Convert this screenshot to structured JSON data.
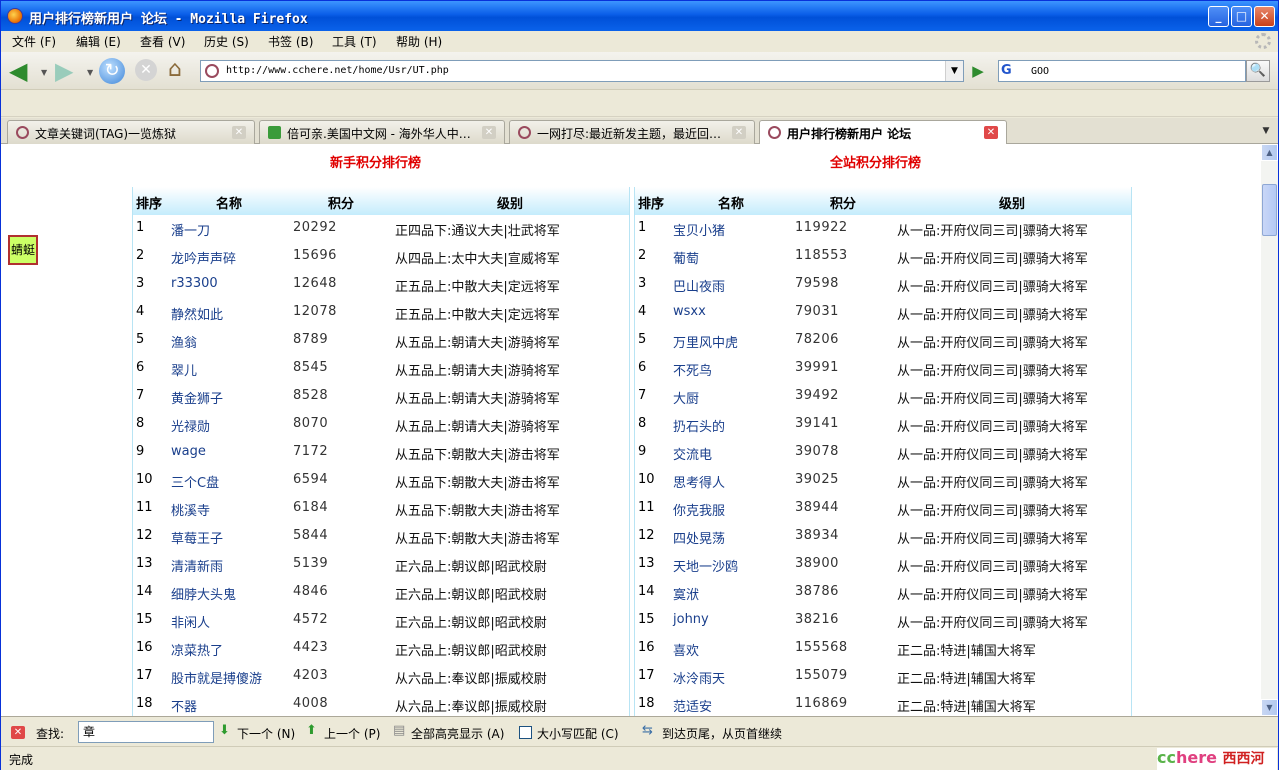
{
  "window": {
    "title": "用户排行榜新用户  论坛 - Mozilla Firefox"
  },
  "menu": [
    "文件 (F)",
    "编辑 (E)",
    "查看 (V)",
    "历史 (S)",
    "书签 (B)",
    "工具 (T)",
    "帮助 (H)"
  ],
  "nav": {
    "url": "http://www.cchere.net/home/Usr/UT.php",
    "search_engine": "G",
    "search_value": "GOO"
  },
  "tabs": [
    {
      "label": "文章关键词(TAG)一览炼狱",
      "active": false
    },
    {
      "label": "倍可亲.美国中文网 - 海外华人中…",
      "active": false
    },
    {
      "label": "一网打尽:最近新发主题，最近回…",
      "active": false
    },
    {
      "label": "用户排行榜新用户  论坛",
      "active": true
    }
  ],
  "page": {
    "badge": "蜻蜓",
    "headers": {
      "rank": "排序",
      "name": "名称",
      "score": "积分",
      "level": "级别"
    },
    "newbie": {
      "title": "新手积分排行榜",
      "rows": [
        {
          "rank": "1",
          "name": "潘一刀",
          "score": "20292",
          "level": "正四品下:通议大夫|壮武将军"
        },
        {
          "rank": "2",
          "name": "龙吟声声碎",
          "score": "15696",
          "level": "从四品上:太中大夫|宣威将军"
        },
        {
          "rank": "3",
          "name": "r33300",
          "score": "12648",
          "level": "正五品上:中散大夫|定远将军"
        },
        {
          "rank": "4",
          "name": "静然如此",
          "score": "12078",
          "level": "正五品上:中散大夫|定远将军"
        },
        {
          "rank": "5",
          "name": "渔翁",
          "score": "8789",
          "level": "从五品上:朝请大夫|游骑将军"
        },
        {
          "rank": "6",
          "name": "翠儿",
          "score": "8545",
          "level": "从五品上:朝请大夫|游骑将军"
        },
        {
          "rank": "7",
          "name": "黄金狮子",
          "score": "8528",
          "level": "从五品上:朝请大夫|游骑将军"
        },
        {
          "rank": "8",
          "name": "光禄勋",
          "score": "8070",
          "level": "从五品上:朝请大夫|游骑将军"
        },
        {
          "rank": "9",
          "name": "wage",
          "score": "7172",
          "level": "从五品下:朝散大夫|游击将军"
        },
        {
          "rank": "10",
          "name": "三个C盘",
          "score": "6594",
          "level": "从五品下:朝散大夫|游击将军"
        },
        {
          "rank": "11",
          "name": "桃溪寺",
          "score": "6184",
          "level": "从五品下:朝散大夫|游击将军"
        },
        {
          "rank": "12",
          "name": "草莓王子",
          "score": "5844",
          "level": "从五品下:朝散大夫|游击将军"
        },
        {
          "rank": "13",
          "name": "清清新雨",
          "score": "5139",
          "level": "正六品上:朝议郎|昭武校尉"
        },
        {
          "rank": "14",
          "name": "细脖大头鬼",
          "score": "4846",
          "level": "正六品上:朝议郎|昭武校尉"
        },
        {
          "rank": "15",
          "name": "非闲人",
          "score": "4572",
          "level": "正六品上:朝议郎|昭武校尉"
        },
        {
          "rank": "16",
          "name": "凉菜热了",
          "score": "4423",
          "level": "正六品上:朝议郎|昭武校尉"
        },
        {
          "rank": "17",
          "name": "股市就是搏傻游",
          "score": "4203",
          "level": "从六品上:奉议郎|振威校尉"
        },
        {
          "rank": "18",
          "name": "不器",
          "score": "4008",
          "level": "从六品上:奉议郎|振威校尉"
        }
      ]
    },
    "site": {
      "title": "全站积分排行榜",
      "rows": [
        {
          "rank": "1",
          "name": "宝贝小猪",
          "score": "119922",
          "level": "从一品:开府仪同三司|骠骑大将军"
        },
        {
          "rank": "2",
          "name": "葡萄",
          "score": "118553",
          "level": "从一品:开府仪同三司|骠骑大将军"
        },
        {
          "rank": "3",
          "name": "巴山夜雨",
          "score": "79598",
          "level": "从一品:开府仪同三司|骠骑大将军"
        },
        {
          "rank": "4",
          "name": "wsxx",
          "score": "79031",
          "level": "从一品:开府仪同三司|骠骑大将军"
        },
        {
          "rank": "5",
          "name": "万里风中虎",
          "score": "78206",
          "level": "从一品:开府仪同三司|骠骑大将军"
        },
        {
          "rank": "6",
          "name": "不死鸟",
          "score": "39991",
          "level": "从一品:开府仪同三司|骠骑大将军"
        },
        {
          "rank": "7",
          "name": "大厨",
          "score": "39492",
          "level": "从一品:开府仪同三司|骠骑大将军"
        },
        {
          "rank": "8",
          "name": "扔石头的",
          "score": "39141",
          "level": "从一品:开府仪同三司|骠骑大将军"
        },
        {
          "rank": "9",
          "name": "交流电",
          "score": "39078",
          "level": "从一品:开府仪同三司|骠骑大将军"
        },
        {
          "rank": "10",
          "name": "思考得人",
          "score": "39025",
          "level": "从一品:开府仪同三司|骠骑大将军"
        },
        {
          "rank": "11",
          "name": "你克我服",
          "score": "38944",
          "level": "从一品:开府仪同三司|骠骑大将军"
        },
        {
          "rank": "12",
          "name": "四处晃荡",
          "score": "38934",
          "level": "从一品:开府仪同三司|骠骑大将军"
        },
        {
          "rank": "13",
          "name": "天地一沙鸥",
          "score": "38900",
          "level": "从一品:开府仪同三司|骠骑大将军"
        },
        {
          "rank": "14",
          "name": "寞洑",
          "score": "38786",
          "level": "从一品:开府仪同三司|骠骑大将军"
        },
        {
          "rank": "15",
          "name": "johny",
          "score": "38216",
          "level": "从一品:开府仪同三司|骠骑大将军"
        },
        {
          "rank": "16",
          "name": "喜欢",
          "score": "155568",
          "level": "正二品:特进|辅国大将军"
        },
        {
          "rank": "17",
          "name": "冰泠雨天",
          "score": "155079",
          "level": "正二品:特进|辅国大将军"
        },
        {
          "rank": "18",
          "name": "范适安",
          "score": "116869",
          "level": "正二品:特进|辅国大将军"
        }
      ]
    }
  },
  "findbar": {
    "label": "查找:",
    "value": "章",
    "next": "下一个 (N)",
    "prev": "上一个 (P)",
    "highlight": "全部高亮显示 (A)",
    "match_case": "大小写匹配 (C)",
    "message": "到达页尾，从页首继续"
  },
  "status": {
    "text": "完成",
    "brand": [
      "cc",
      "here",
      "西西河"
    ]
  }
}
